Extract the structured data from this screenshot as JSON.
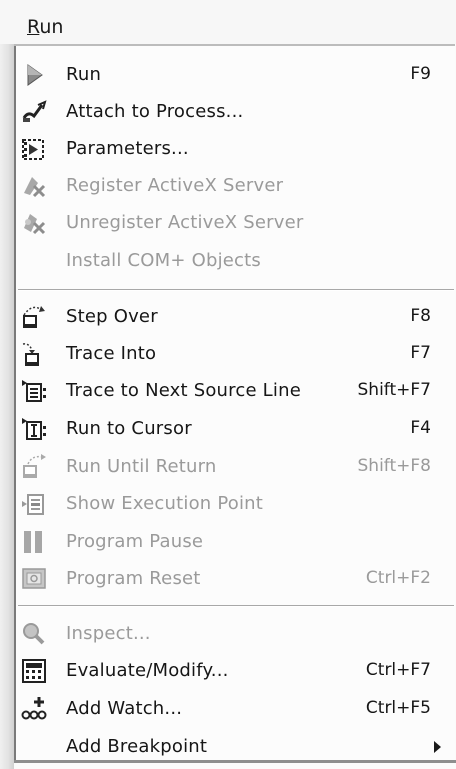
{
  "menubar": {
    "title_mnemonic": "R",
    "title_rest": "un"
  },
  "menu": {
    "groups": [
      [
        {
          "label": "Run",
          "shortcut": "F9",
          "enabled": true,
          "icon": "run-play-icon"
        },
        {
          "label": "Attach to Process...",
          "shortcut": "",
          "enabled": true,
          "icon": "attach-process-icon"
        },
        {
          "label": "Parameters...",
          "shortcut": "",
          "enabled": true,
          "icon": "parameters-icon"
        },
        {
          "label": "Register ActiveX Server",
          "shortcut": "",
          "enabled": false,
          "icon": "register-activex-icon"
        },
        {
          "label": "Unregister ActiveX Server",
          "shortcut": "",
          "enabled": false,
          "icon": "unregister-activex-icon"
        },
        {
          "label": "Install COM+ Objects",
          "shortcut": "",
          "enabled": false,
          "icon": ""
        }
      ],
      [
        {
          "label": "Step Over",
          "shortcut": "F8",
          "enabled": true,
          "icon": "step-over-icon"
        },
        {
          "label": "Trace Into",
          "shortcut": "F7",
          "enabled": true,
          "icon": "trace-into-icon"
        },
        {
          "label": "Trace to Next Source Line",
          "shortcut": "Shift+F7",
          "enabled": true,
          "icon": "trace-next-line-icon"
        },
        {
          "label": "Run to Cursor",
          "shortcut": "F4",
          "enabled": true,
          "icon": "run-to-cursor-icon"
        },
        {
          "label": "Run Until Return",
          "shortcut": "Shift+F8",
          "enabled": false,
          "icon": "run-until-return-icon"
        },
        {
          "label": "Show Execution Point",
          "shortcut": "",
          "enabled": false,
          "icon": "execution-point-icon"
        },
        {
          "label": "Program Pause",
          "shortcut": "",
          "enabled": false,
          "icon": "pause-icon"
        },
        {
          "label": "Program Reset",
          "shortcut": "Ctrl+F2",
          "enabled": false,
          "icon": "reset-icon"
        }
      ],
      [
        {
          "label": "Inspect...",
          "shortcut": "",
          "enabled": false,
          "icon": "inspect-icon"
        },
        {
          "label": "Evaluate/Modify...",
          "shortcut": "Ctrl+F7",
          "enabled": true,
          "icon": "calculator-icon"
        },
        {
          "label": "Add Watch...",
          "shortcut": "Ctrl+F5",
          "enabled": true,
          "icon": "add-watch-icon"
        },
        {
          "label": "Add Breakpoint",
          "shortcut": "",
          "enabled": true,
          "icon": "",
          "submenu": true
        }
      ]
    ]
  }
}
